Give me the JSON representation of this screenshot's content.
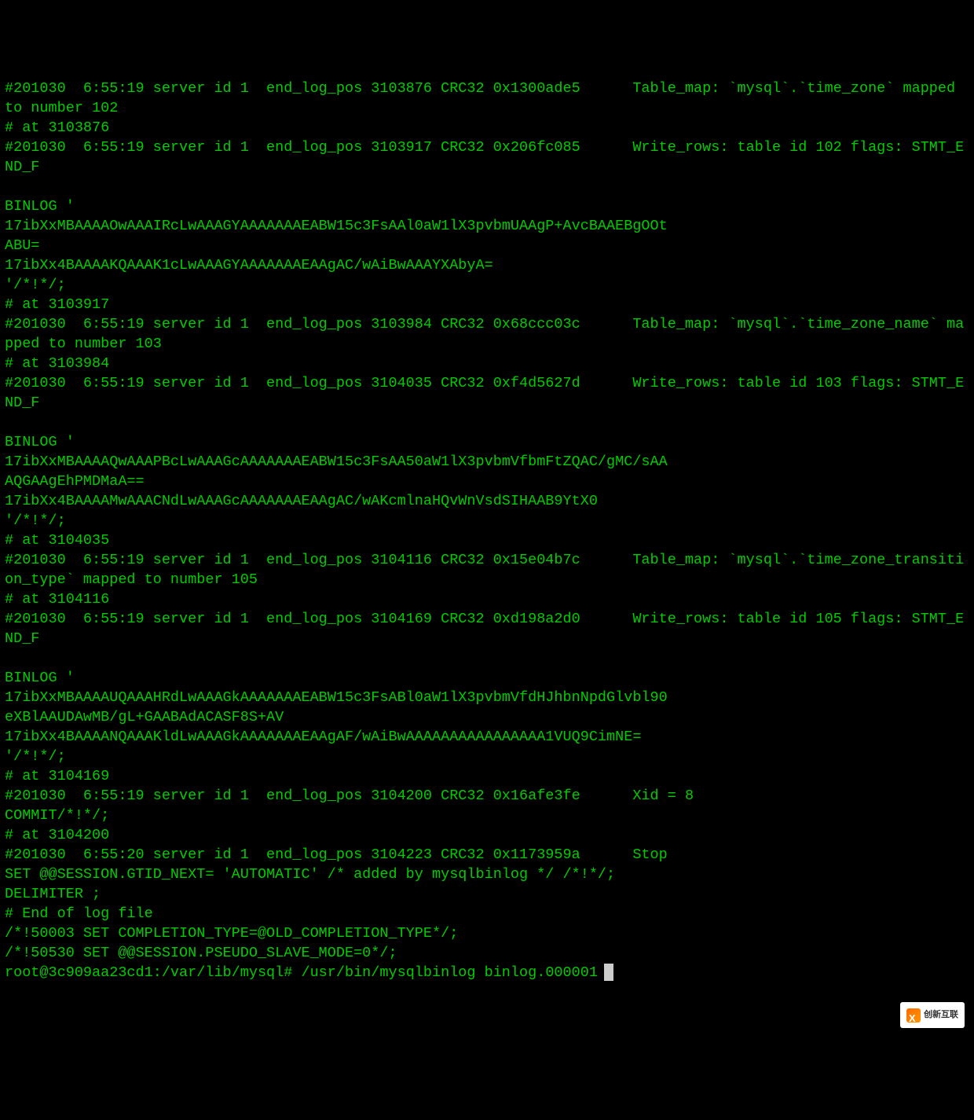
{
  "terminal": {
    "lines": [
      "#201030  6:55:19 server id 1  end_log_pos 3103876 CRC32 0x1300ade5      Table_map: `mysql`.`time_zone` mapped to number 102",
      "# at 3103876",
      "#201030  6:55:19 server id 1  end_log_pos 3103917 CRC32 0x206fc085      Write_rows: table id 102 flags: STMT_END_F",
      "",
      "BINLOG '",
      "17ibXxMBAAAAOwAAAIRcLwAAAGYAAAAAAAEABW15c3FsAAl0aW1lX3pvbmUAAgP+AvcBAAEBgOOt",
      "ABU=",
      "17ibXx4BAAAAKQAAAK1cLwAAAGYAAAAAAAEAAgAC/wAiBwAAAYXAbyA=",
      "'/*!*/;",
      "# at 3103917",
      "#201030  6:55:19 server id 1  end_log_pos 3103984 CRC32 0x68ccc03c      Table_map: `mysql`.`time_zone_name` mapped to number 103",
      "# at 3103984",
      "#201030  6:55:19 server id 1  end_log_pos 3104035 CRC32 0xf4d5627d      Write_rows: table id 103 flags: STMT_END_F",
      "",
      "BINLOG '",
      "17ibXxMBAAAAQwAAAPBcLwAAAGcAAAAAAAEABW15c3FsAA50aW1lX3pvbmVfbmFtZQAC/gMC/sAA",
      "AQGAAgEhPMDMaA==",
      "17ibXx4BAAAAMwAAACNdLwAAAGcAAAAAAAEAAgAC/wAKcmlnaHQvWnVsdSIHAAB9YtX0",
      "'/*!*/;",
      "# at 3104035",
      "#201030  6:55:19 server id 1  end_log_pos 3104116 CRC32 0x15e04b7c      Table_map: `mysql`.`time_zone_transition_type` mapped to number 105",
      "# at 3104116",
      "#201030  6:55:19 server id 1  end_log_pos 3104169 CRC32 0xd198a2d0      Write_rows: table id 105 flags: STMT_END_F",
      "",
      "BINLOG '",
      "17ibXxMBAAAAUQAAAHRdLwAAAGkAAAAAAAEABW15c3FsABl0aW1lX3pvbmVfdHJhbnNpdGlvbl90",
      "eXBlAAUDAwMB/gL+GAABAdACASF8S+AV",
      "17ibXx4BAAAANQAAAKldLwAAAGkAAAAAAAEAAgAF/wAiBwAAAAAAAAAAAAAAAA1VUQ9CimNE=",
      "'/*!*/;",
      "# at 3104169",
      "#201030  6:55:19 server id 1  end_log_pos 3104200 CRC32 0x16afe3fe      Xid = 8",
      "COMMIT/*!*/;",
      "# at 3104200",
      "#201030  6:55:20 server id 1  end_log_pos 3104223 CRC32 0x1173959a      Stop",
      "SET @@SESSION.GTID_NEXT= 'AUTOMATIC' /* added by mysqlbinlog */ /*!*/;",
      "DELIMITER ;",
      "# End of log file",
      "/*!50003 SET COMPLETION_TYPE=@OLD_COMPLETION_TYPE*/;",
      "/*!50530 SET @@SESSION.PSEUDO_SLAVE_MODE=0*/;"
    ],
    "prompt": "root@3c909aa23cd1:/var/lib/mysql# ",
    "command": "/usr/bin/mysqlbinlog binlog.000001"
  },
  "watermark": {
    "text": "创新互联"
  }
}
